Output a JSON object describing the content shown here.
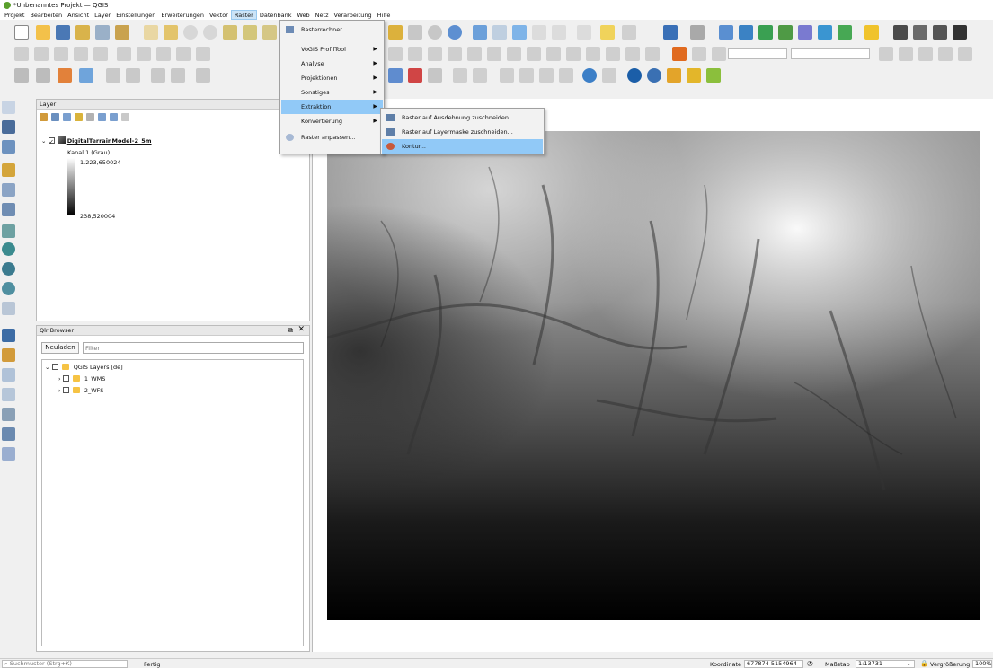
{
  "window": {
    "title": "*Unbenanntes Projekt — QGIS"
  },
  "menubar": {
    "items": [
      "Projekt",
      "Bearbeiten",
      "Ansicht",
      "Layer",
      "Einstellungen",
      "Erweiterungen",
      "Vektor",
      "Raster",
      "Datenbank",
      "Web",
      "Netz",
      "Verarbeitung",
      "Hilfe"
    ],
    "active": "Raster"
  },
  "raster_menu": {
    "items": [
      {
        "label": "Rasterrechner...",
        "submenu": false,
        "icon": "raster-calculator-icon"
      },
      {
        "label": "VoGIS ProfilTool",
        "submenu": true,
        "icon": ""
      },
      {
        "label": "Analyse",
        "submenu": true,
        "icon": ""
      },
      {
        "label": "Projektionen",
        "submenu": true,
        "icon": ""
      },
      {
        "label": "Sonstiges",
        "submenu": true,
        "icon": ""
      },
      {
        "label": "Extraktion",
        "submenu": true,
        "icon": "",
        "highlighted": true
      },
      {
        "label": "Konvertierung",
        "submenu": true,
        "icon": ""
      },
      {
        "label": "Raster anpassen...",
        "submenu": false,
        "icon": "georeferencer-icon"
      }
    ]
  },
  "extraktion_submenu": {
    "items": [
      {
        "label": "Raster auf Ausdehnung zuschneiden...",
        "icon": "clip-extent-icon"
      },
      {
        "label": "Raster auf Layermaske zuschneiden...",
        "icon": "clip-mask-icon"
      },
      {
        "label": "Kontur...",
        "icon": "contour-icon",
        "highlighted": true
      }
    ]
  },
  "layer_panel": {
    "title": "Layer",
    "layer_name": "DigitalTerrainModel-2_5m",
    "band": "Kanal 1 (Grau)",
    "max_value": "1.223,650024",
    "min_value": "238,520004"
  },
  "browser_panel": {
    "title": "Qlr Browser",
    "reload_label": "Neuladen",
    "filter_placeholder": "Filter",
    "items": [
      "QGIS Layers [de]",
      "1_WMS",
      "2_WFS"
    ]
  },
  "statusbar": {
    "search_placeholder": "Suchmuster (Strg+K)",
    "status": "Fertig",
    "coord_label": "Koordinate",
    "coord_value": "677874  5154964",
    "scale_label": "Maßstab",
    "scale_value": "1:13731",
    "magnifier_label": "Vergrößerung",
    "magnifier_value": "100%"
  }
}
